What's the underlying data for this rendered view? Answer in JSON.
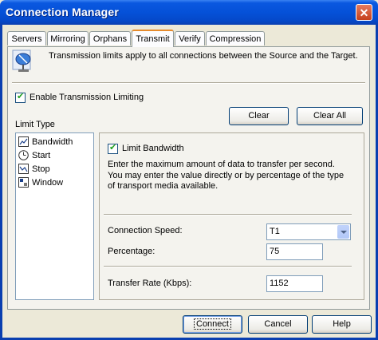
{
  "window": {
    "title": "Connection Manager",
    "close_glyph": "✕"
  },
  "tabs": [
    {
      "label": "Servers"
    },
    {
      "label": "Mirroring"
    },
    {
      "label": "Orphans"
    },
    {
      "label": "Transmit",
      "active": true
    },
    {
      "label": "Verify"
    },
    {
      "label": "Compression"
    }
  ],
  "transmit": {
    "info_icon": "satellite-dish-icon",
    "info_text": "Transmission limits apply to all connections between the Source and the Target.",
    "enable_limiting_label": "Enable Transmission Limiting",
    "enable_limiting_checked": true,
    "clear_label": "Clear",
    "clear_all_label": "Clear All",
    "limit_type_label": "Limit Type",
    "limit_types": [
      {
        "label": "Bandwidth",
        "icon": "chart-icon",
        "selected": true
      },
      {
        "label": "Start",
        "icon": "clock-icon"
      },
      {
        "label": "Stop",
        "icon": "stop-chart-icon"
      },
      {
        "label": "Window",
        "icon": "window-icon"
      }
    ],
    "limit_bandwidth_label": "Limit Bandwidth",
    "limit_bandwidth_checked": true,
    "description": "Enter the maximum amount of data to transfer per second.  You may enter the value directly or by percentage of the type of transport media available.",
    "connection_speed_label": "Connection Speed:",
    "connection_speed_value": "T1",
    "percentage_label": "Percentage:",
    "percentage_value": "75",
    "transfer_rate_label": "Transfer Rate (Kbps):",
    "transfer_rate_value": "1152"
  },
  "footer": {
    "connect_label": "Connect",
    "cancel_label": "Cancel",
    "help_label": "Help"
  }
}
